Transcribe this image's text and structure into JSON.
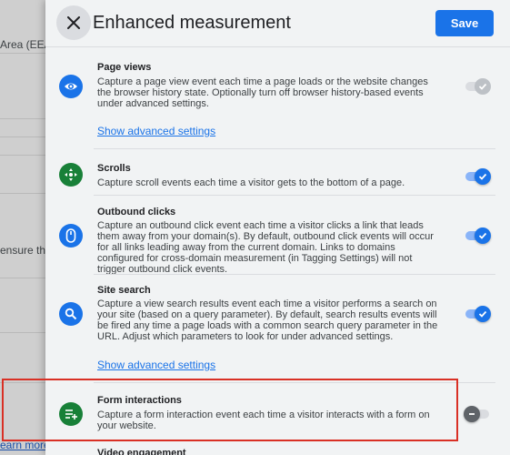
{
  "background": {
    "region_text": "Area (EEA)",
    "ensure_text": "ensure tha",
    "learn_more": "earn more"
  },
  "header": {
    "title": "Enhanced measurement",
    "save_label": "Save"
  },
  "items": [
    {
      "title": "Page views",
      "description": "Capture a page view event each time a page loads or the website changes the browser history state. Optionally turn off browser history-based events under advanced settings.",
      "toggle_state": "on-disabled",
      "icon": "eye-icon",
      "link": "Show advanced settings"
    },
    {
      "title": "Scrolls",
      "description": "Capture scroll events each time a visitor gets to the bottom of a page.",
      "toggle_state": "on",
      "icon": "crosshair-icon"
    },
    {
      "title": "Outbound clicks",
      "description": "Capture an outbound click event each time a visitor clicks a link that leads them away from your domain(s). By default, outbound click events will occur for all links leading away from the current domain. Links to domains configured for cross-domain measurement (in Tagging Settings) will not trigger outbound click events.",
      "toggle_state": "on",
      "icon": "mouse-icon"
    },
    {
      "title": "Site search",
      "description": "Capture a view search results event each time a visitor performs a search on your site (based on a query parameter). By default, search results events will be fired any time a page loads with a common search query parameter in the URL. Adjust which parameters to look for under advanced settings.",
      "toggle_state": "on",
      "icon": "search-icon",
      "link": "Show advanced settings"
    },
    {
      "title": "Form interactions",
      "description": "Capture a form interaction event each time a visitor interacts with a form on your website.",
      "toggle_state": "off",
      "icon": "form-icon"
    },
    {
      "title": "Video engagement"
    }
  ],
  "colors": {
    "accent": "#1a73e8",
    "green_icon": "#188038",
    "highlight_border": "#d93025"
  }
}
